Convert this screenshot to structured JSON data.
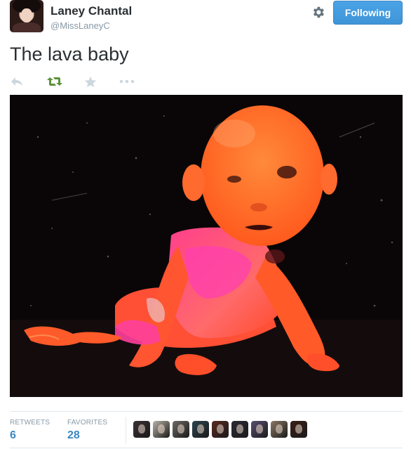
{
  "user": {
    "name": "Laney Chantal",
    "handle": "@MissLaneyC"
  },
  "follow_button": {
    "label": "Following"
  },
  "tweet": {
    "text": "The lava baby"
  },
  "actions": {
    "reply_icon": "reply-icon",
    "retweet_icon": "retweet-icon",
    "favorite_icon": "star-icon",
    "more_icon": "more-icon"
  },
  "stats": {
    "retweets_label": "RETWEETS",
    "retweets_value": "6",
    "favorites_label": "FAVORITES",
    "favorites_value": "28"
  },
  "favoriters": [
    {
      "color": "#3a3136"
    },
    {
      "color": "#b9b3a8"
    },
    {
      "color": "#6e6a66"
    },
    {
      "color": "#2d4450"
    },
    {
      "color": "#5a2a22"
    },
    {
      "color": "#2c2b36"
    },
    {
      "color": "#5b4f73"
    },
    {
      "color": "#8c7866"
    },
    {
      "color": "#3b2015"
    }
  ],
  "colors": {
    "accent": "#3b88c3",
    "retweet_green": "#5c913b",
    "muted": "#8899a6"
  }
}
